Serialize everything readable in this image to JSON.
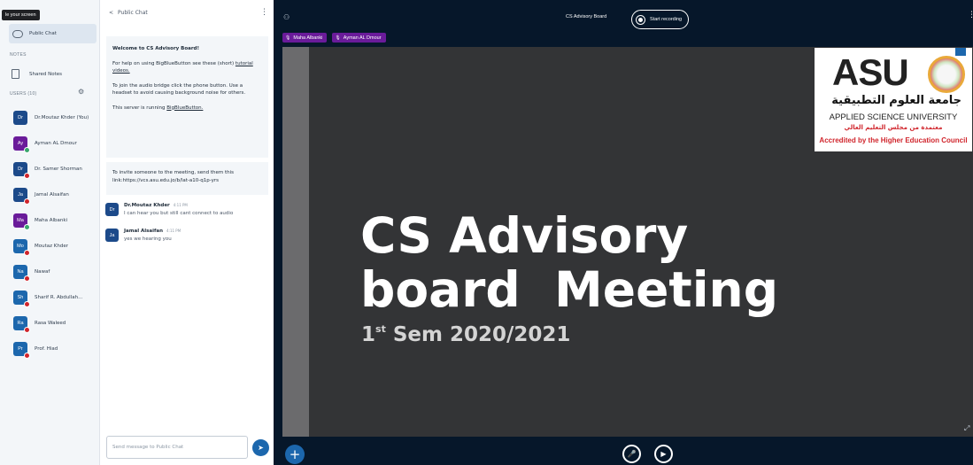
{
  "tooltip": "le your screen",
  "sidebar": {
    "messages_item": "Public Chat",
    "notes_header": "NOTES",
    "notes_item": "Shared Notes",
    "users_header": "USERS (10)",
    "users": [
      {
        "initials": "Dr",
        "name": "Dr.Moutaz Khder (You)",
        "color": "#1c4a8a",
        "dot": ""
      },
      {
        "initials": "Ay",
        "name": "Ayman AL Dmour",
        "color": "#6a1b9a",
        "dot": "#3aa76d"
      },
      {
        "initials": "Dr",
        "name": "Dr. Samer Shorman",
        "color": "#1c4a8a",
        "dot": "#d0252c"
      },
      {
        "initials": "Ja",
        "name": "Jamal Alsaifan",
        "color": "#1c4a8a",
        "dot": "#d0252c"
      },
      {
        "initials": "Ma",
        "name": "Maha Albanki",
        "color": "#6a1b9a",
        "dot": "#3aa76d"
      },
      {
        "initials": "Mo",
        "name": "Moutaz Khder",
        "color": "#1c67ad",
        "dot": "#d0252c"
      },
      {
        "initials": "Na",
        "name": "Nawaf",
        "color": "#1c67ad",
        "dot": "#d0252c"
      },
      {
        "initials": "Sh",
        "name": "Sharif R. Abdullah...",
        "color": "#1c67ad",
        "dot": "#d0252c"
      },
      {
        "initials": "Ra",
        "name": "Rasa Waleed",
        "color": "#1c67ad",
        "dot": "#d0252c"
      },
      {
        "initials": "Pr",
        "name": "Prof. Hiad",
        "color": "#1c67ad",
        "dot": "#d0252c"
      }
    ]
  },
  "chat": {
    "back_arrow": "<",
    "title": "Public Chat",
    "welcome_title": "Welcome to CS Advisory Board!",
    "welcome_help_1": "For help on using BigBlueButton see these (short)",
    "welcome_help_link": "tutorial videos.",
    "welcome_audio": "To join the audio bridge click the phone button. Use a headset to avoid causing background noise for others.",
    "welcome_server_1": "This server is running",
    "welcome_server_link": "BigBlueButton.",
    "invite": "To invite someone to the meeting, send them this link:https://vcs.asu.edu.jo/b/lat-a10-q1p-yrs",
    "messages": [
      {
        "initials": "Dr",
        "name": "Dr.Moutaz Khder",
        "time": "4:11 PM",
        "text": "I can hear you but still cant connect to audio"
      },
      {
        "initials": "Ja",
        "name": "Jamal Alsaifan",
        "time": "4:11 PM",
        "text": "yes we hearing you"
      }
    ],
    "input_placeholder": "Send message to Public Chat",
    "send_icon": "➤"
  },
  "stage": {
    "users_icon": "⚇",
    "room_title": "CS Advisory Board",
    "record_label": "Start recording",
    "talkers": [
      "Maha Albanki",
      "Ayman AL Dmour"
    ],
    "slide_title": "CS Advisory\nboard  Meeting",
    "slide_sub_num": "1",
    "slide_sub_sup": "st",
    "slide_sub_rest": " Sem 2020/2021",
    "logo_asu": "ASU",
    "logo_arabic": "جامعة العلوم التطبيقية",
    "logo_english": "APPLIED SCIENCE UNIVERSITY",
    "logo_arabic_accr": "معتمدة من مجلس التعليم العالي",
    "logo_english_accr": "Accredited by the Higher Education Council",
    "plus_label": "+",
    "mic_icon": "🎤",
    "cam_icon": "▶"
  },
  "colors": {
    "stage_bg": "#06172a",
    "accent": "#1c67ad",
    "talker": "#6a1b9a",
    "logo_red": "#d0252c"
  }
}
